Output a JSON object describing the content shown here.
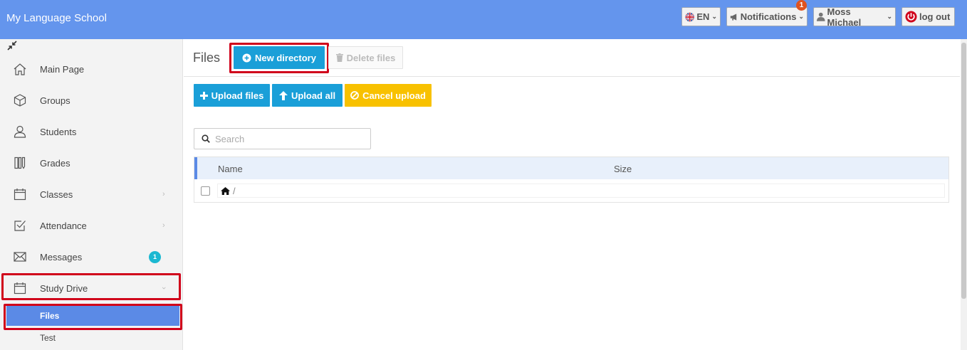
{
  "header": {
    "brand": "My Language School",
    "language": "EN",
    "notifications_label": "Notifications",
    "notifications_count": "1",
    "user_name": "Moss Michael",
    "logout_label": "log out"
  },
  "sidebar": {
    "items": [
      {
        "label": "Main Page",
        "icon": "home-icon"
      },
      {
        "label": "Groups",
        "icon": "cube-icon"
      },
      {
        "label": "Students",
        "icon": "user-icon"
      },
      {
        "label": "Grades",
        "icon": "grades-icon"
      },
      {
        "label": "Classes",
        "icon": "calendar-icon"
      },
      {
        "label": "Attendance",
        "icon": "checkbox-icon"
      },
      {
        "label": "Messages",
        "icon": "envelope-icon",
        "badge": "1"
      },
      {
        "label": "Study Drive",
        "icon": "calendar-icon"
      }
    ],
    "subitems": [
      {
        "label": "Files"
      },
      {
        "label": "Test"
      }
    ]
  },
  "main": {
    "title": "Files",
    "new_directory_label": "New directory",
    "delete_files_label": "Delete files",
    "upload_files_label": "Upload files",
    "upload_all_label": "Upload all",
    "cancel_upload_label": "Cancel upload",
    "search_placeholder": "Search",
    "table": {
      "columns": [
        "Name",
        "Size"
      ],
      "path": "/"
    }
  },
  "colors": {
    "header": "#6495ed",
    "primary": "#1a9fd8",
    "warning": "#f8c100",
    "highlight": "#d0021b",
    "active_item": "#5b8ae6"
  }
}
